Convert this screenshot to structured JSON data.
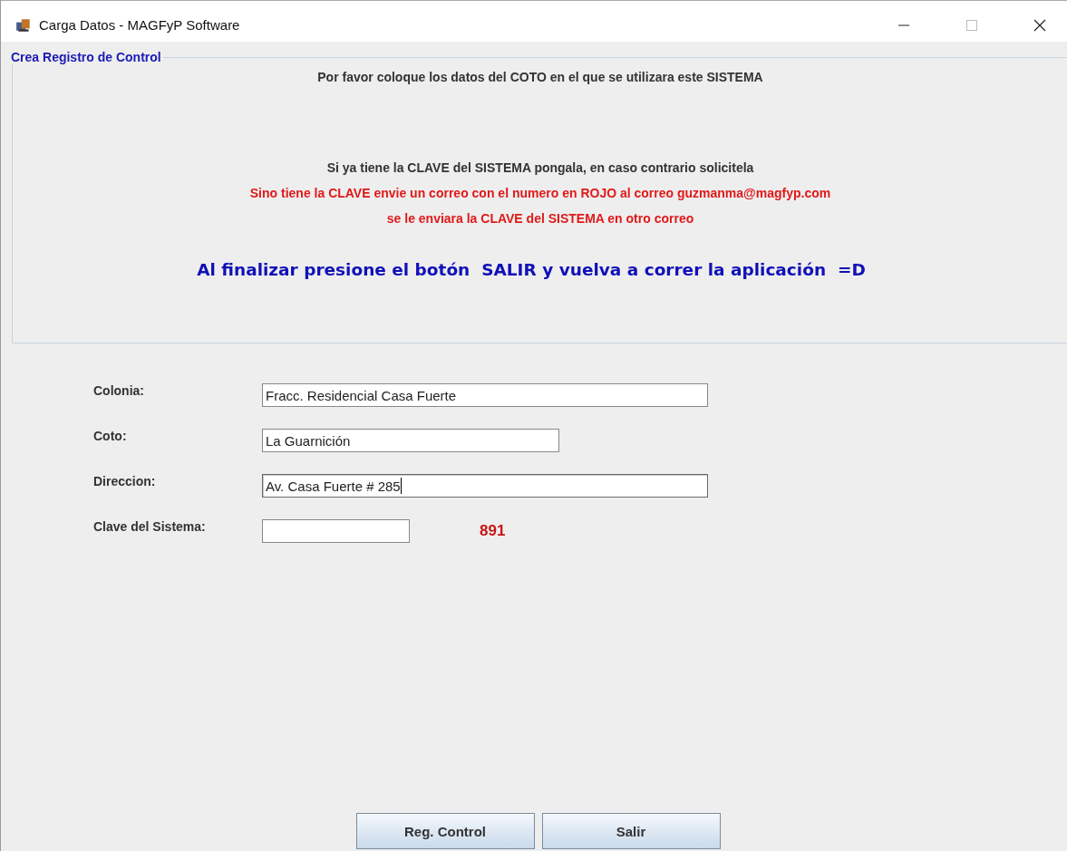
{
  "window": {
    "title": "Carga Datos - MAGFyP Software"
  },
  "group": {
    "title": "Crea Registro de Control",
    "messages": [
      {
        "kind": "normal",
        "text": "Por favor coloque los datos del COTO en el que se utilizara este SISTEMA"
      },
      {
        "kind": "gap",
        "text": "Si ya tiene la CLAVE del SISTEMA pongala, en caso contrario solicitela"
      },
      {
        "kind": "alert",
        "text": "Sino tiene la CLAVE envie un correo con el numero en ROJO al correo guzmanma@magfyp.com"
      },
      {
        "kind": "alert",
        "text": "se le enviara la CLAVE del SISTEMA en otro correo"
      },
      {
        "kind": "highlight",
        "text": "Al finalizar presione el botón  SALIR y vuelva a correr la aplicación  =D"
      }
    ]
  },
  "fields": [
    {
      "label": "Colonia:",
      "value": "Fracc. Residencial Casa Fuerte",
      "focused": false
    },
    {
      "label": "Coto:",
      "value": "La Guarnición",
      "focused": false
    },
    {
      "label": "Direccion:",
      "value": "Av. Casa Fuerte # 285",
      "focused": true
    },
    {
      "label": "Clave del Sistema:",
      "focused": false,
      "code": "891"
    }
  ],
  "buttons": [
    "Reg. Control",
    "Salir"
  ]
}
